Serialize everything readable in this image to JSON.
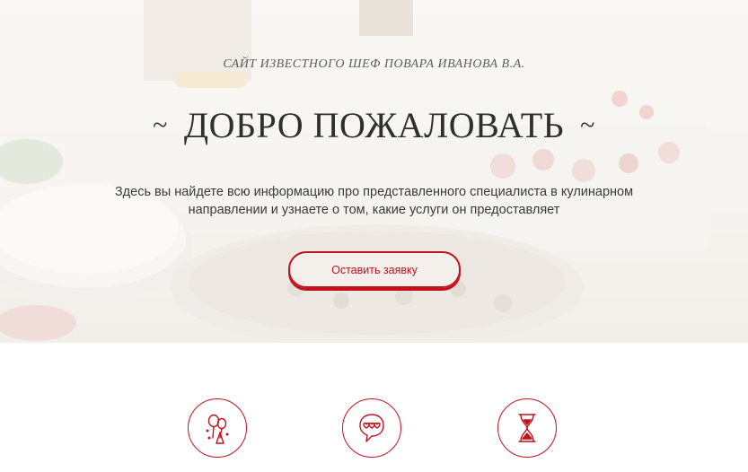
{
  "hero": {
    "subtitle": "САЙТ ИЗВЕСТНОГО ШЕФ ПОВАРА ИВАНОВА В.А.",
    "title": "ДОБРО ПОЖАЛОВАТЬ",
    "tilde_left": "~",
    "tilde_right": "~",
    "description": "Здесь вы найдете всю информацию про представленного специалиста в кулинарном направлении и узнаете о том, какие услуги он предоставляет",
    "cta_label": "Оставить заявку"
  },
  "features": {
    "icons": [
      "balloons-icon",
      "hearts-speech-bubble-icon",
      "hourglass-icon"
    ]
  },
  "colors": {
    "accent": "#c1121f",
    "heading": "#2f2f2f",
    "text": "#3a3a3a"
  }
}
